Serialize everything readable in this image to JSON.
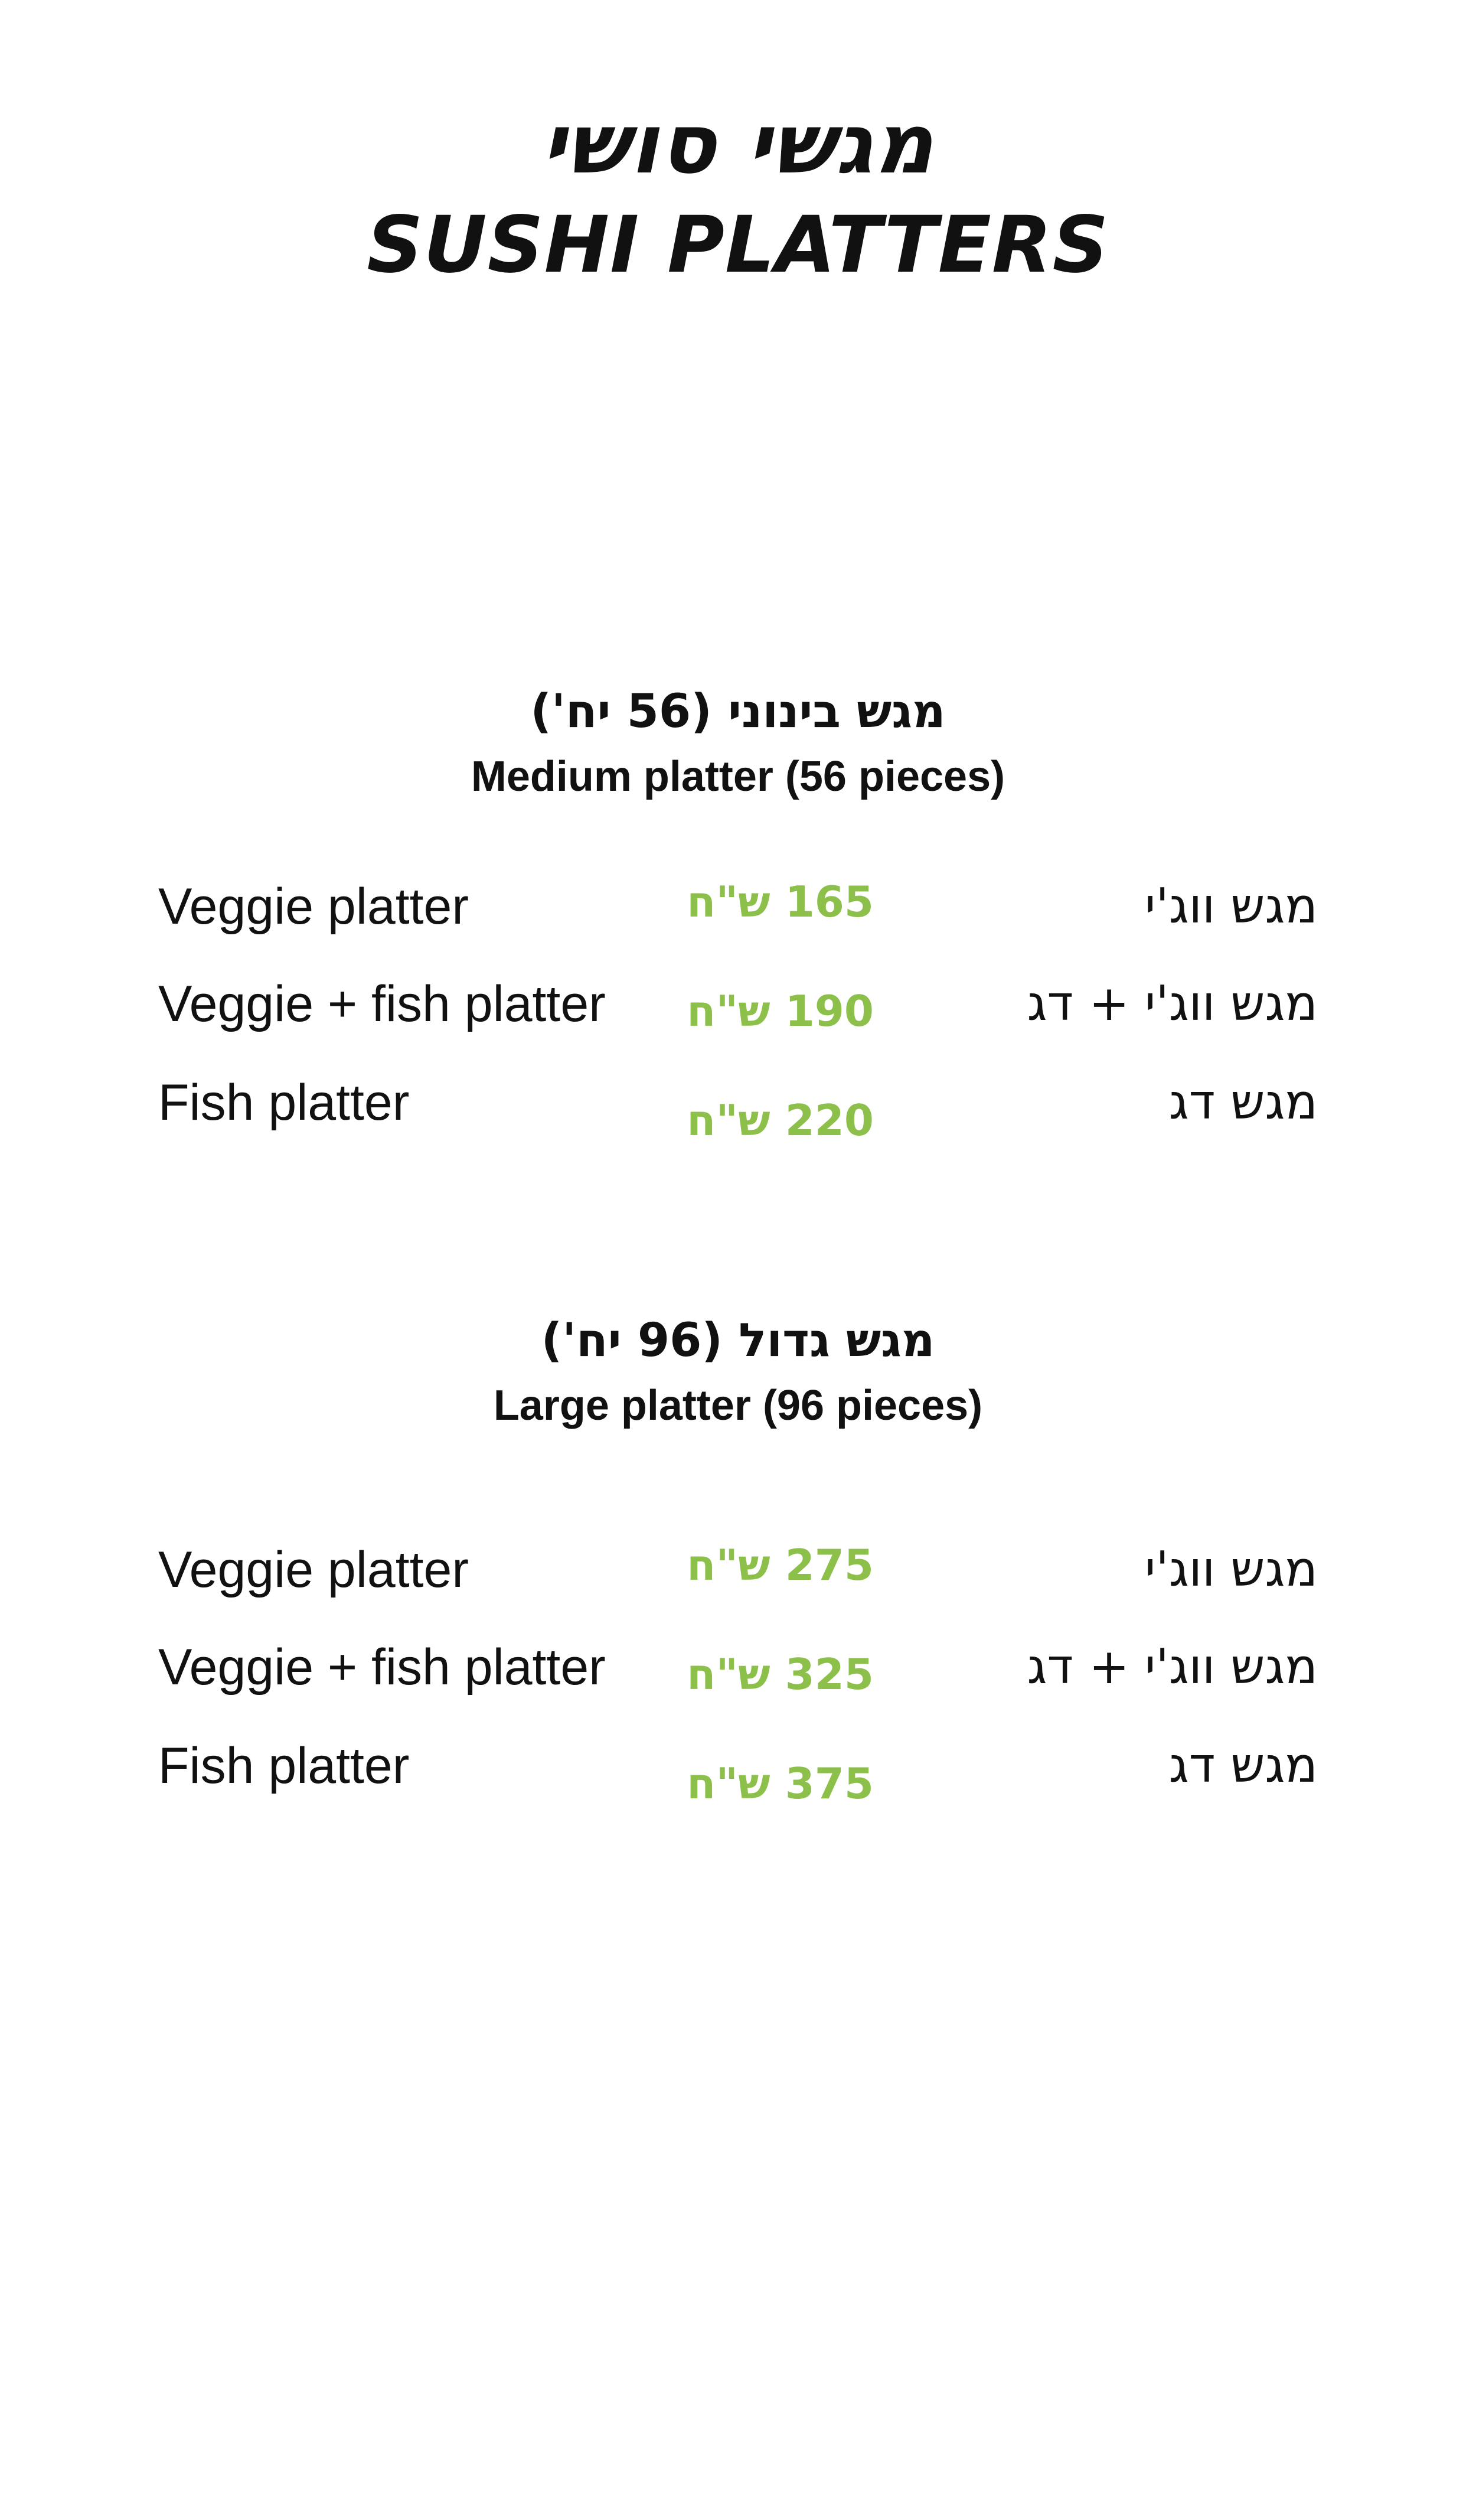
{
  "header": {
    "title_he": "מגשי סושי",
    "title_en": "SUSHI PLATTERS"
  },
  "sections": [
    {
      "heading_he": "מגש בינוני (56 יח')",
      "heading_en": "Medium platter (56 pieces)",
      "items": [
        {
          "en": "Veggie platter",
          "price": "165 ש\"ח",
          "he": "מגש ווג'י"
        },
        {
          "en": "Veggie + fish platter",
          "price": "190 ש\"ח",
          "he": "מגש ווג'י + דג"
        },
        {
          "en": "Fish platter",
          "price": "220 ש\"ח",
          "he": "מגש דג"
        }
      ]
    },
    {
      "heading_he": "מגש גדול (96 יח')",
      "heading_en": "Large platter (96 pieces)",
      "items": [
        {
          "en": "Veggie platter",
          "price": "275 ש\"ח",
          "he": "מגש ווג'י"
        },
        {
          "en": "Veggie + fish platter",
          "price": "325 ש\"ח",
          "he": "מגש ווג'י + דג"
        },
        {
          "en": "Fish platter",
          "price": "375 ש\"ח",
          "he": "מגש דג"
        }
      ]
    }
  ],
  "colors": {
    "price": "#8cc04b",
    "text": "#111111",
    "background": "#ffffff"
  }
}
